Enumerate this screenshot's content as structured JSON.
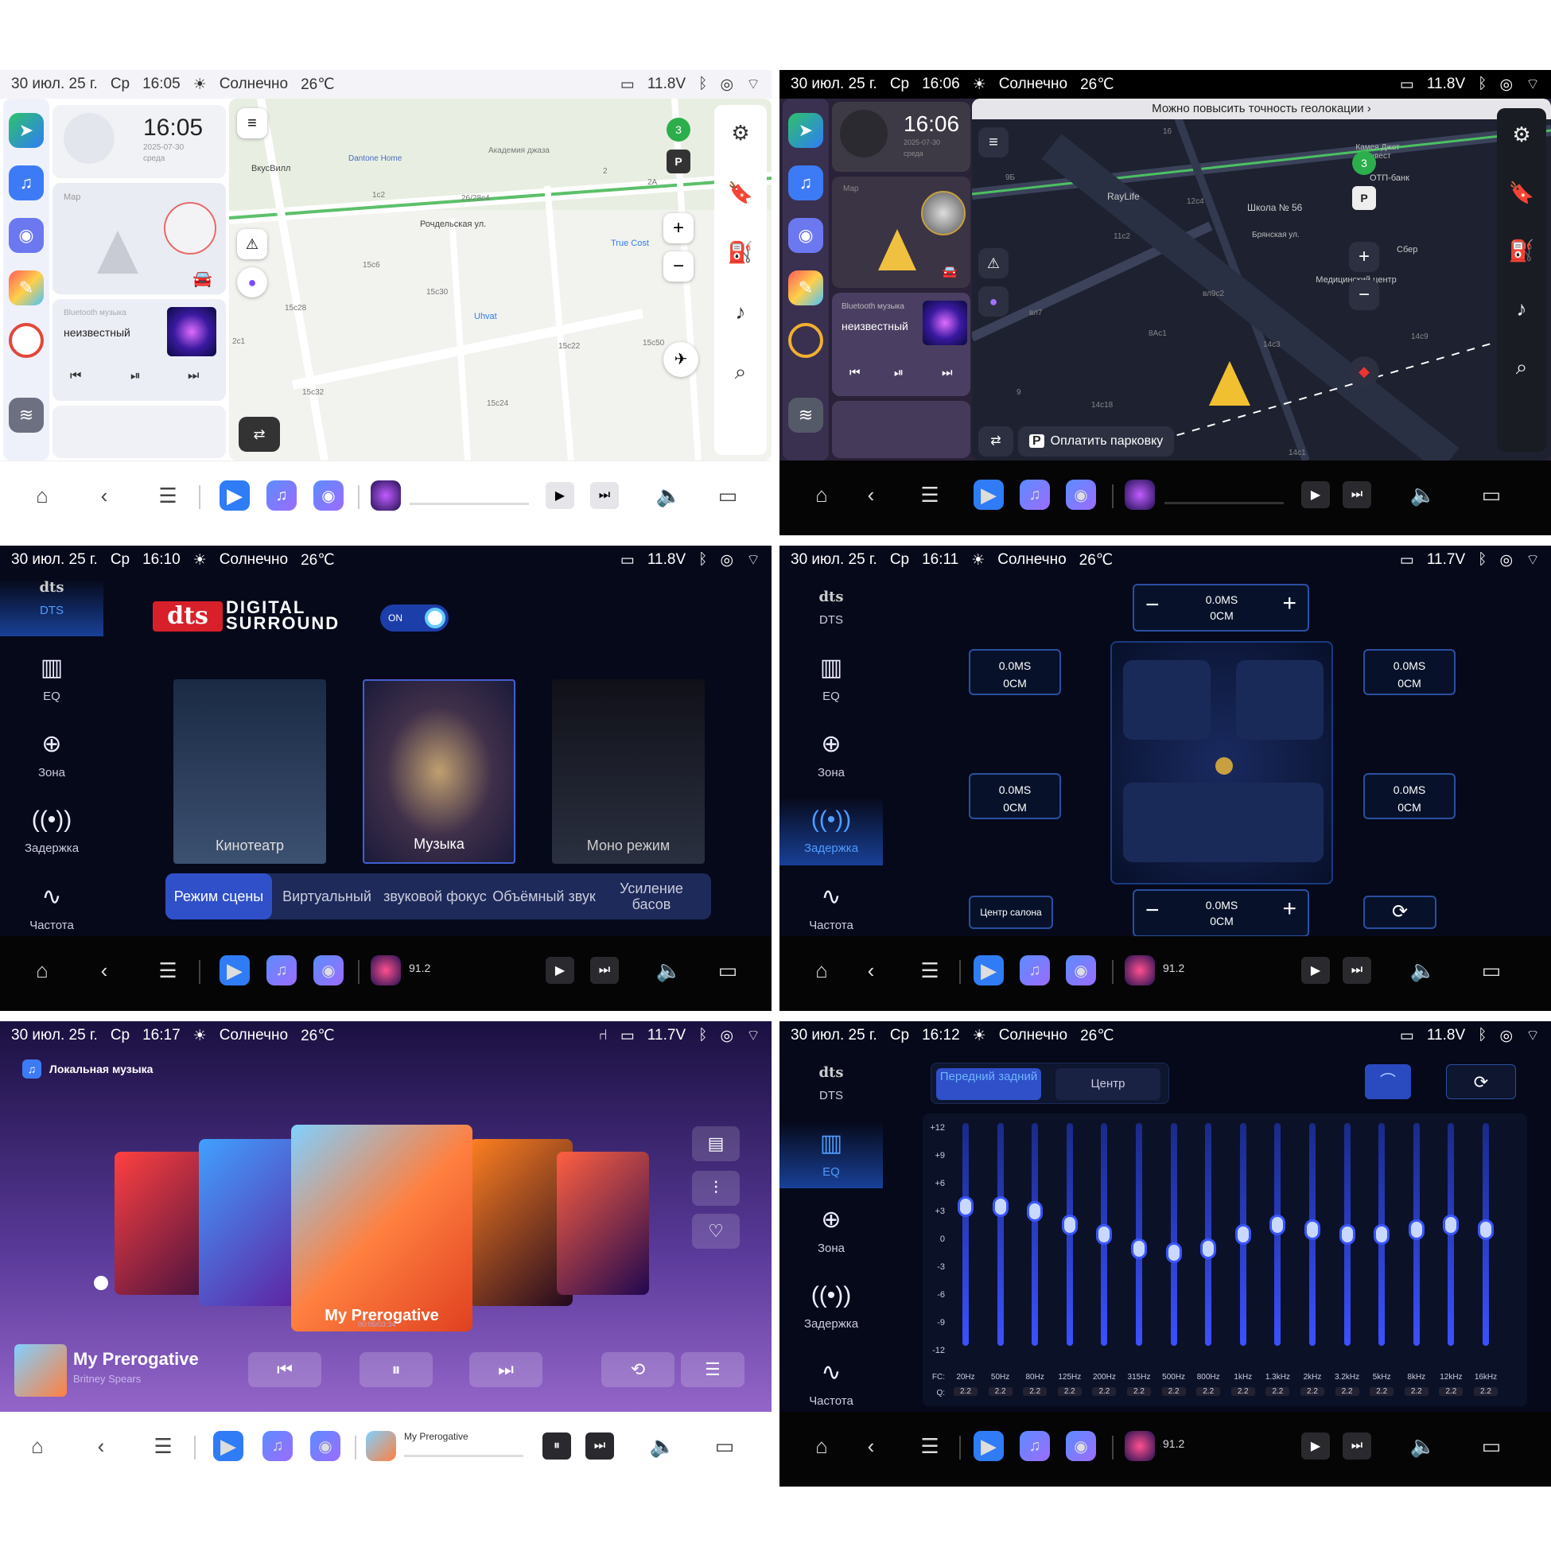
{
  "status": {
    "p1": {
      "date": "30 июл. 25 г.",
      "day": "Ср",
      "time": "16:05",
      "weather": "Солнечно",
      "temp": "26℃",
      "volt": "11.8V"
    },
    "p2": {
      "date": "30 июл. 25 г.",
      "day": "Ср",
      "time": "16:06",
      "weather": "Солнечно",
      "temp": "26℃",
      "volt": "11.8V"
    },
    "p3": {
      "date": "30 июл. 25 г.",
      "day": "Ср",
      "time": "16:10",
      "weather": "Солнечно",
      "temp": "26℃",
      "volt": "11.8V"
    },
    "p4": {
      "date": "30 июл. 25 г.",
      "day": "Ср",
      "time": "16:11",
      "weather": "Солнечно",
      "temp": "26℃",
      "volt": "11.7V"
    },
    "p5": {
      "date": "30 июл. 25 г.",
      "day": "Ср",
      "time": "16:17",
      "weather": "Солнечно",
      "temp": "26℃",
      "volt": "11.7V"
    },
    "p6": {
      "date": "30 июл. 25 г.",
      "day": "Ср",
      "time": "16:12",
      "weather": "Солнечно",
      "temp": "26℃",
      "volt": "11.8V"
    }
  },
  "home1": {
    "clock": "16:05",
    "clock_date": "2025-07-30",
    "clock_day": "среда",
    "map_label": "Map",
    "music_source": "Bluetooth музыка",
    "music_title": "неизвестный"
  },
  "home2": {
    "clock": "16:06",
    "clock_date": "2025-07-30",
    "clock_day": "среда",
    "map_label": "Map",
    "music_source": "Bluetooth музыка",
    "music_title": "неизвестный"
  },
  "map1": {
    "streets": [
      "Рочдельская ул.",
      "Dantone Home",
      "ВкусВилл",
      "True Cost",
      "Uhvat",
      "Академия джаза",
      "15с30",
      "15с28",
      "15с32",
      "15с24",
      "15с22",
      "15с50",
      "15с6",
      "26/28с4",
      "1с2",
      "2с1",
      "2А",
      "2"
    ],
    "badge": "3",
    "parking": "P"
  },
  "map2": {
    "banner": "Можно повысить точность геолокации",
    "pay": "Оплатить парковку",
    "labels": [
      "RayLife",
      "Школа № 56",
      "Брянская ул.",
      "Медицинский центр",
      "ОТП-банк",
      "Камея Джет Инвест",
      "Сбер",
      "12с4",
      "11с2",
      "9Б",
      "8Ас1",
      "14с3",
      "14с9",
      "14с18",
      "14с1",
      "вл9с2",
      "вл7",
      "9",
      "16"
    ],
    "badge": "3",
    "parking": "P"
  },
  "nav": {
    "station": "91.2",
    "track": "My Prerogative"
  },
  "dts": {
    "logo_top": "DIGITAL",
    "logo_bottom": "SURROUND",
    "toggle": "ON",
    "menu": [
      {
        "label": "DTS"
      },
      {
        "label": "EQ"
      },
      {
        "label": "Зона"
      },
      {
        "label": "Задержка"
      },
      {
        "label": "Частота"
      }
    ],
    "cards": [
      "Кинотеатр",
      "Музыка",
      "Моно режим"
    ],
    "tabs": [
      "Режим сцены",
      "Виртуальный",
      "звуковой фокус",
      "Объёмный звук",
      "Усиление басов"
    ]
  },
  "delay": {
    "top": {
      "ms": "0.0MS",
      "cm": "0CM"
    },
    "bottom": {
      "ms": "0.0MS",
      "cm": "0CM"
    },
    "fl": {
      "ms": "0.0MS",
      "cm": "0CM"
    },
    "fr": {
      "ms": "0.0MS",
      "cm": "0CM"
    },
    "rl": {
      "ms": "0.0MS",
      "cm": "0CM"
    },
    "rr": {
      "ms": "0.0MS",
      "cm": "0CM"
    },
    "center_btn": "Центр салона"
  },
  "music": {
    "app_title": "Локальная музыка",
    "album_title": "My Prerogative",
    "time": "00:05/03:34",
    "now_title": "My Prerogative",
    "now_artist": "Britney Spears"
  },
  "eq": {
    "tab_active": "Передний задний",
    "tab_other": "Центр",
    "scale": [
      "+12",
      "+9",
      "+6",
      "+3",
      "0",
      "-3",
      "-6",
      "-9",
      "-12"
    ],
    "fc_label": "FC:",
    "q_label": "Q:",
    "bands": [
      "20Hz",
      "50Hz",
      "80Hz",
      "125Hz",
      "200Hz",
      "315Hz",
      "500Hz",
      "800Hz",
      "1kHz",
      "1.3kHz",
      "2kHz",
      "3.2kHz",
      "5kHz",
      "8kHz",
      "12kHz",
      "16kHz"
    ],
    "q": [
      "2.2",
      "2.2",
      "2.2",
      "2.2",
      "2.2",
      "2.2",
      "2.2",
      "2.2",
      "2.2",
      "2.2",
      "2.2",
      "2.2",
      "2.2",
      "2.2",
      "2.2",
      "2.2"
    ],
    "levels": [
      3,
      3,
      2.5,
      1,
      0,
      -1.5,
      -2,
      -1.5,
      0,
      1,
      0.5,
      0,
      0,
      0.5,
      1,
      0.5
    ]
  },
  "colors": {
    "accent": "#2f7cf6",
    "eq_bar": "#3c50ff",
    "dts_red": "#d8202a"
  }
}
